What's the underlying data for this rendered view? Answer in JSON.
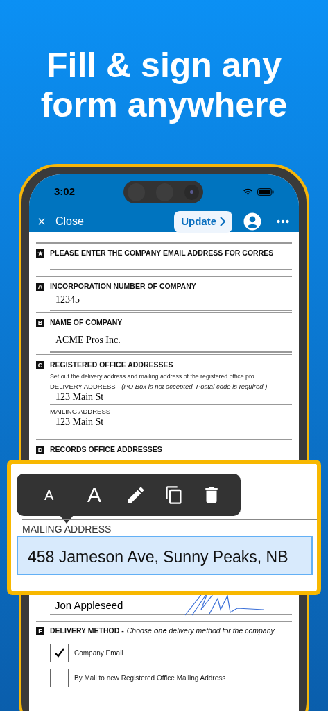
{
  "headline": [
    "Fill & sign any",
    "form anywhere"
  ],
  "status_bar": {
    "time": "3:02"
  },
  "nav": {
    "close_label": "Close",
    "update_button": "Update"
  },
  "form": {
    "sections": [
      {
        "kind": "star",
        "title": "PLEASE ENTER THE COMPANY EMAIL ADDRESS FOR CORRES"
      },
      {
        "kind": "letter",
        "marker": "A",
        "title": "INCORPORATION NUMBER OF COMPANY",
        "value": "12345"
      },
      {
        "kind": "letter",
        "marker": "B",
        "title": "NAME OF COMPANY",
        "value": "ACME Pros Inc."
      },
      {
        "kind": "letter",
        "marker": "C",
        "title": "REGISTERED OFFICE ADDRESSES",
        "note": "Set out the delivery address and mailing address of the registered office pro",
        "subfields": [
          {
            "label": "DELIVERY ADDRESS - *(PO Box is not accepted. Postal code is required.)*",
            "value": "123 Main St"
          },
          {
            "label": "MAILING ADDRESS",
            "value": "123 Main St"
          }
        ]
      },
      {
        "kind": "letter",
        "marker": "D",
        "title": "RECORDS OFFICE ADDRESSES"
      }
    ],
    "signature": {
      "name": "Jon Appleseed"
    },
    "delivery": {
      "marker": "F",
      "title": "DELIVERY METHOD -",
      "instruction": "Choose **one** delivery method for the company",
      "options": [
        {
          "label": "Company Email",
          "checked": true
        },
        {
          "label": "By Mail to new Registered Office Mailing Address",
          "checked": false
        }
      ]
    }
  },
  "zoom_overlay": {
    "toolbar": [
      {
        "kind": "text-small",
        "label": "A"
      },
      {
        "kind": "text-large",
        "label": "A"
      },
      {
        "kind": "edit"
      },
      {
        "kind": "copy"
      },
      {
        "kind": "delete"
      }
    ],
    "label": "MAILING ADDRESS",
    "value": "458 Jameson Ave, Sunny Peaks, NB"
  }
}
